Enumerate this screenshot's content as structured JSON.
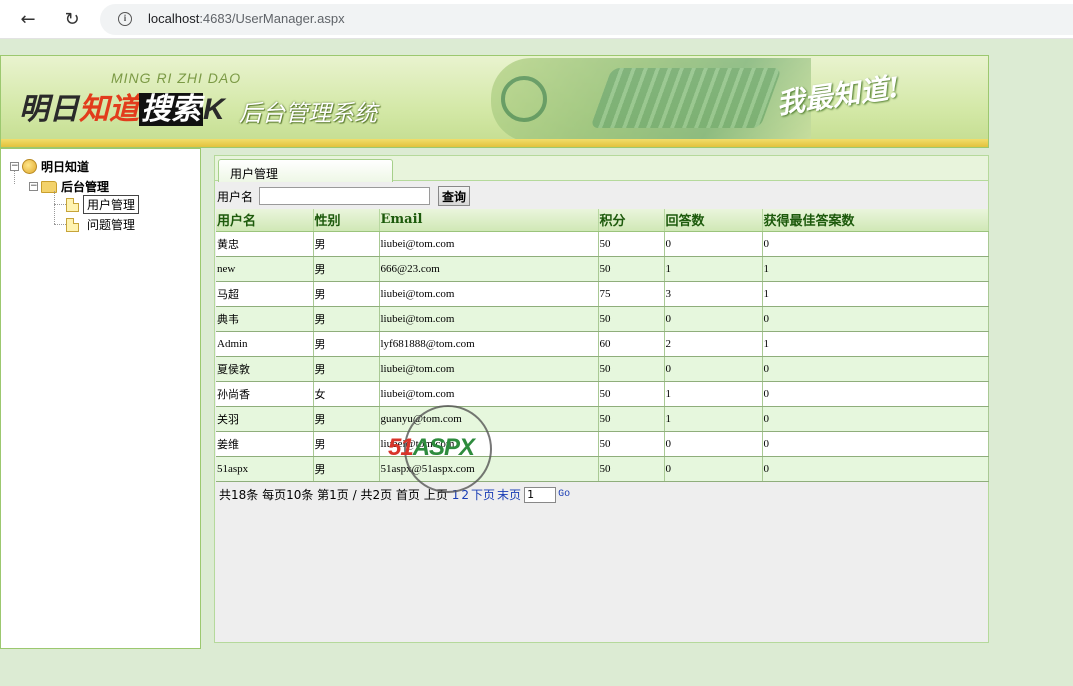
{
  "browser": {
    "url_host": "localhost",
    "url_rest": ":4683/UserManager.aspx"
  },
  "banner": {
    "subtitle": "MING RI ZHI DAO",
    "logo_part1": "明日",
    "logo_part2": "知道",
    "logo_part3": "搜索",
    "logo_part4": "K",
    "system_name": "后台管理系统",
    "slogan": "我最知道!"
  },
  "tree": {
    "root": "明日知道",
    "admin": "后台管理",
    "items": [
      "用户管理",
      "问题管理"
    ]
  },
  "main": {
    "tab": "用户管理",
    "search_label": "用户名",
    "search_value": "",
    "search_button": "查询"
  },
  "table": {
    "headers": [
      "用户名",
      "性别",
      "Email",
      "积分",
      "回答数",
      "获得最佳答案数"
    ],
    "rows": [
      [
        "黄忠",
        "男",
        "liubei@tom.com",
        "50",
        "0",
        "0"
      ],
      [
        "new",
        "男",
        "666@23.com",
        "50",
        "1",
        "1"
      ],
      [
        "马超",
        "男",
        "liubei@tom.com",
        "75",
        "3",
        "1"
      ],
      [
        "典韦",
        "男",
        "liubei@tom.com",
        "50",
        "0",
        "0"
      ],
      [
        "Admin",
        "男",
        "lyf681888@tom.com",
        "60",
        "2",
        "1"
      ],
      [
        "夏侯敦",
        "男",
        "liubei@tom.com",
        "50",
        "0",
        "0"
      ],
      [
        "孙尚香",
        "女",
        "liubei@tom.com",
        "50",
        "1",
        "0"
      ],
      [
        "关羽",
        "男",
        "guanyu@tom.com",
        "50",
        "1",
        "0"
      ],
      [
        "姜维",
        "男",
        "liubei@tom.com",
        "50",
        "0",
        "0"
      ],
      [
        "51aspx",
        "男",
        "51aspx@51aspx.com",
        "50",
        "0",
        "0"
      ]
    ]
  },
  "pager": {
    "summary": "共18条 每页10条 第1页 / 共2页 首页 上页",
    "page1": "1",
    "page2": "2",
    "next": "下页",
    "last": "末页",
    "goto_value": "1",
    "go": "Go"
  },
  "watermark": {
    "text_red": "51",
    "text_green": "ASPX"
  }
}
